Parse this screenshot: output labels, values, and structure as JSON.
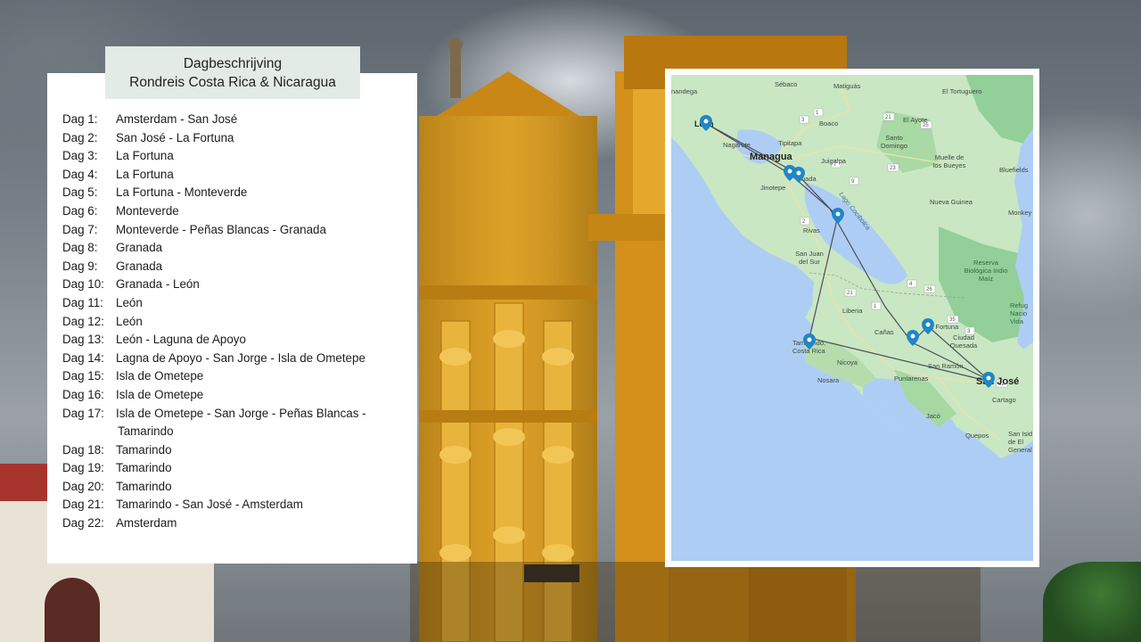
{
  "header": {
    "title_line1": "Dagbeschrijving",
    "title_line2": "Rondreis Costa Rica & Nicaragua"
  },
  "itinerary": [
    {
      "day": "Dag 1:",
      "route": "Amsterdam - San José"
    },
    {
      "day": "Dag 2:",
      "route": "San José - La Fortuna"
    },
    {
      "day": "Dag 3:",
      "route": "La Fortuna"
    },
    {
      "day": "Dag 4:",
      "route": "La Fortuna"
    },
    {
      "day": "Dag 5:",
      "route": "La Fortuna - Monteverde"
    },
    {
      "day": "Dag 6:",
      "route": "Monteverde"
    },
    {
      "day": "Dag 7:",
      "route": "Monteverde - Peñas Blancas - Granada"
    },
    {
      "day": "Dag 8:",
      "route": "Granada"
    },
    {
      "day": "Dag 9:",
      "route": "Granada"
    },
    {
      "day": "Dag 10:",
      "route": "Granada - León"
    },
    {
      "day": "Dag 11:",
      "route": "León"
    },
    {
      "day": "Dag 12:",
      "route": "León"
    },
    {
      "day": "Dag 13:",
      "route": "León - Laguna de Apoyo"
    },
    {
      "day": "Dag 14:",
      "route": "Lagna de Apoyo - San Jorge - Isla de Ometepe"
    },
    {
      "day": "Dag 15:",
      "route": "Isla de Ometepe"
    },
    {
      "day": "Dag 16:",
      "route": "Isla de Ometepe"
    },
    {
      "day": "Dag 17:",
      "route": "Isla de Ometepe - San Jorge - Peñas Blancas -"
    },
    {
      "day": "",
      "route": "Tamarindo"
    },
    {
      "day": "Dag 18:",
      "route": "Tamarindo"
    },
    {
      "day": "Dag 19:",
      "route": "Tamarindo"
    },
    {
      "day": "Dag 20:",
      "route": "Tamarindo"
    },
    {
      "day": "Dag 21:",
      "route": "Tamarindo - San José - Amsterdam"
    },
    {
      "day": "Dag 22:",
      "route": "Amsterdam"
    }
  ],
  "map": {
    "labels": {
      "chinandega": "nandega",
      "leon": "León",
      "sebaco": "Sébaco",
      "matiguas": "Matiguás",
      "el_tortuguero": "El Tortuguero",
      "nagarote": "Nagarote",
      "tipitapa": "Tipitapa",
      "boaco": "Boaco",
      "el_ayote": "El Ayote",
      "managua": "Managua",
      "juigalpa": "Juigalpa",
      "santo_domingo": "Santo Domingo",
      "muelle": "Muelle de los Bueyes",
      "bluefields": "Bluefields",
      "jinotepe": "Jinotepe",
      "granada": "nada",
      "lago": "Lago Cocibolca",
      "nueva_guinea": "Nueva Guinea",
      "rivas": "Rivas",
      "monkey": "Monkey",
      "sjds": "San Juan del Sur",
      "reserva": "Reserva Biológica Indio Maíz",
      "liberia": "Liberia",
      "refugio": "Refug Nacio Vida",
      "canas": "Cañas",
      "la_fortuna": "La Fortuna",
      "ciudad_quesada": "Ciudad Quesada",
      "tamarindo": "Tamarindo, Costa Rica",
      "nicoya": "Nicoya",
      "san_ramon": "San Ramón",
      "nosara": "Nosara",
      "puntarenas": "Puntarenas",
      "san_jose": "San José",
      "cartago": "Cartago",
      "jaco": "Jacó",
      "quepos": "Quepos",
      "san_isidro": "San Isid de El General"
    },
    "road_numbers": [
      "1",
      "3",
      "2",
      "7",
      "9",
      "21",
      "25",
      "23",
      "26",
      "35",
      "32",
      "21",
      "1",
      "4",
      "3"
    ],
    "colors": {
      "water": "#aecdf5",
      "land": "#c7e6c2",
      "forest": "#93cf9a",
      "route": "#4a4f58",
      "pin": "#1f86c8"
    }
  }
}
